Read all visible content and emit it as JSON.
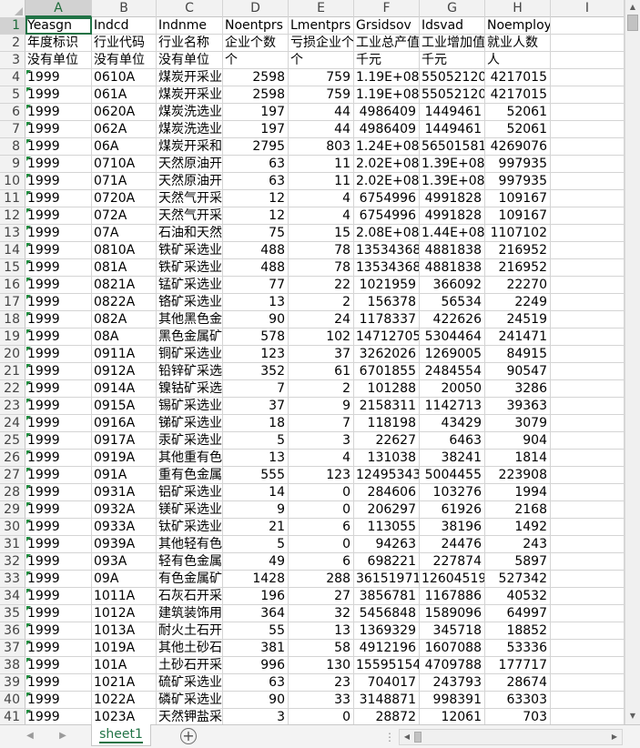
{
  "columns": [
    {
      "letter": "A"
    },
    {
      "letter": "B"
    },
    {
      "letter": "C"
    },
    {
      "letter": "D"
    },
    {
      "letter": "E"
    },
    {
      "letter": "F"
    },
    {
      "letter": "G"
    },
    {
      "letter": "H"
    },
    {
      "letter": "I"
    }
  ],
  "rows": [
    {
      "n": "1",
      "a": "Yeasgn",
      "b": "Indcd",
      "c": "Indnme",
      "d": "Noentprs",
      "e": "Lmentprs",
      "f": "Grsidsov",
      "g": "Idsvad",
      "h": "Noemploy",
      "text": true
    },
    {
      "n": "2",
      "a": "年度标识",
      "b": "行业代码",
      "c": "行业名称",
      "d": "企业个数",
      "e": "亏损企业个",
      "f": "工业总产值",
      "g": "工业增加值",
      "h": "就业人数",
      "text": true
    },
    {
      "n": "3",
      "a": "没有单位",
      "b": "没有单位",
      "c": "没有单位",
      "d": "个",
      "e": "个",
      "f": "千元",
      "g": "千元",
      "h": "人",
      "text": true
    },
    {
      "n": "4",
      "a": "1999",
      "b": "0610A",
      "c": "煤炭开采业",
      "d": "2598",
      "e": "759",
      "f": "1.19E+08",
      "g": "55052120",
      "h": "4217015"
    },
    {
      "n": "5",
      "a": "1999",
      "b": "061A",
      "c": "煤炭开采业",
      "d": "2598",
      "e": "759",
      "f": "1.19E+08",
      "g": "55052120",
      "h": "4217015"
    },
    {
      "n": "6",
      "a": "1999",
      "b": "0620A",
      "c": "煤炭洗选业",
      "d": "197",
      "e": "44",
      "f": "4986409",
      "g": "1449461",
      "h": "52061"
    },
    {
      "n": "7",
      "a": "1999",
      "b": "062A",
      "c": "煤炭洗选业",
      "d": "197",
      "e": "44",
      "f": "4986409",
      "g": "1449461",
      "h": "52061"
    },
    {
      "n": "8",
      "a": "1999",
      "b": "06A",
      "c": "煤炭开采和",
      "d": "2795",
      "e": "803",
      "f": "1.24E+08",
      "g": "56501581",
      "h": "4269076"
    },
    {
      "n": "9",
      "a": "1999",
      "b": "0710A",
      "c": "天然原油开",
      "d": "63",
      "e": "11",
      "f": "2.02E+08",
      "g": "1.39E+08",
      "h": "997935"
    },
    {
      "n": "10",
      "a": "1999",
      "b": "071A",
      "c": "天然原油开",
      "d": "63",
      "e": "11",
      "f": "2.02E+08",
      "g": "1.39E+08",
      "h": "997935"
    },
    {
      "n": "11",
      "a": "1999",
      "b": "0720A",
      "c": "天然气开采",
      "d": "12",
      "e": "4",
      "f": "6754996",
      "g": "4991828",
      "h": "109167"
    },
    {
      "n": "12",
      "a": "1999",
      "b": "072A",
      "c": "天然气开采",
      "d": "12",
      "e": "4",
      "f": "6754996",
      "g": "4991828",
      "h": "109167"
    },
    {
      "n": "13",
      "a": "1999",
      "b": "07A",
      "c": "石油和天然",
      "d": "75",
      "e": "15",
      "f": "2.08E+08",
      "g": "1.44E+08",
      "h": "1107102"
    },
    {
      "n": "14",
      "a": "1999",
      "b": "0810A",
      "c": "铁矿采选业",
      "d": "488",
      "e": "78",
      "f": "13534368",
      "g": "4881838",
      "h": "216952"
    },
    {
      "n": "15",
      "a": "1999",
      "b": "081A",
      "c": "铁矿采选业",
      "d": "488",
      "e": "78",
      "f": "13534368",
      "g": "4881838",
      "h": "216952"
    },
    {
      "n": "16",
      "a": "1999",
      "b": "0821A",
      "c": "锰矿采选业",
      "d": "77",
      "e": "22",
      "f": "1021959",
      "g": "366092",
      "h": "22270"
    },
    {
      "n": "17",
      "a": "1999",
      "b": "0822A",
      "c": "铬矿采选业",
      "d": "13",
      "e": "2",
      "f": "156378",
      "g": "56534",
      "h": "2249"
    },
    {
      "n": "18",
      "a": "1999",
      "b": "082A",
      "c": "其他黑色金",
      "d": "90",
      "e": "24",
      "f": "1178337",
      "g": "422626",
      "h": "24519"
    },
    {
      "n": "19",
      "a": "1999",
      "b": "08A",
      "c": "黑色金属矿",
      "d": "578",
      "e": "102",
      "f": "14712705",
      "g": "5304464",
      "h": "241471"
    },
    {
      "n": "20",
      "a": "1999",
      "b": "0911A",
      "c": "铜矿采选业",
      "d": "123",
      "e": "37",
      "f": "3262026",
      "g": "1269005",
      "h": "84915"
    },
    {
      "n": "21",
      "a": "1999",
      "b": "0912A",
      "c": "铅锌矿采选",
      "d": "352",
      "e": "61",
      "f": "6701855",
      "g": "2484554",
      "h": "90547"
    },
    {
      "n": "22",
      "a": "1999",
      "b": "0914A",
      "c": "镍钴矿采选",
      "d": "7",
      "e": "2",
      "f": "101288",
      "g": "20050",
      "h": "3286"
    },
    {
      "n": "23",
      "a": "1999",
      "b": "0915A",
      "c": "锡矿采选业",
      "d": "37",
      "e": "9",
      "f": "2158311",
      "g": "1142713",
      "h": "39363"
    },
    {
      "n": "24",
      "a": "1999",
      "b": "0916A",
      "c": "锑矿采选业",
      "d": "18",
      "e": "7",
      "f": "118198",
      "g": "43429",
      "h": "3079"
    },
    {
      "n": "25",
      "a": "1999",
      "b": "0917A",
      "c": "汞矿采选业",
      "d": "5",
      "e": "3",
      "f": "22627",
      "g": "6463",
      "h": "904"
    },
    {
      "n": "26",
      "a": "1999",
      "b": "0919A",
      "c": "其他重有色",
      "d": "13",
      "e": "4",
      "f": "131038",
      "g": "38241",
      "h": "1814"
    },
    {
      "n": "27",
      "a": "1999",
      "b": "091A",
      "c": "重有色金属",
      "d": "555",
      "e": "123",
      "f": "12495343",
      "g": "5004455",
      "h": "223908"
    },
    {
      "n": "28",
      "a": "1999",
      "b": "0931A",
      "c": "铝矿采选业",
      "d": "14",
      "e": "0",
      "f": "284606",
      "g": "103276",
      "h": "1994"
    },
    {
      "n": "29",
      "a": "1999",
      "b": "0932A",
      "c": "镁矿采选业",
      "d": "9",
      "e": "0",
      "f": "206297",
      "g": "61926",
      "h": "2168"
    },
    {
      "n": "30",
      "a": "1999",
      "b": "0933A",
      "c": "钛矿采选业",
      "d": "21",
      "e": "6",
      "f": "113055",
      "g": "38196",
      "h": "1492"
    },
    {
      "n": "31",
      "a": "1999",
      "b": "0939A",
      "c": "其他轻有色",
      "d": "5",
      "e": "0",
      "f": "94263",
      "g": "24476",
      "h": "243"
    },
    {
      "n": "32",
      "a": "1999",
      "b": "093A",
      "c": "轻有色金属",
      "d": "49",
      "e": "6",
      "f": "698221",
      "g": "227874",
      "h": "5897"
    },
    {
      "n": "33",
      "a": "1999",
      "b": "09A",
      "c": "有色金属矿",
      "d": "1428",
      "e": "288",
      "f": "36151971",
      "g": "12604519",
      "h": "527342"
    },
    {
      "n": "34",
      "a": "1999",
      "b": "1011A",
      "c": "石灰石开采",
      "d": "196",
      "e": "27",
      "f": "3856781",
      "g": "1167886",
      "h": "40532"
    },
    {
      "n": "35",
      "a": "1999",
      "b": "1012A",
      "c": "建筑装饰用",
      "d": "364",
      "e": "32",
      "f": "5456848",
      "g": "1589096",
      "h": "64997"
    },
    {
      "n": "36",
      "a": "1999",
      "b": "1013A",
      "c": "耐火土石开",
      "d": "55",
      "e": "13",
      "f": "1369329",
      "g": "345718",
      "h": "18852"
    },
    {
      "n": "37",
      "a": "1999",
      "b": "1019A",
      "c": "其他土砂石",
      "d": "381",
      "e": "58",
      "f": "4912196",
      "g": "1607088",
      "h": "53336"
    },
    {
      "n": "38",
      "a": "1999",
      "b": "101A",
      "c": "土砂石开采",
      "d": "996",
      "e": "130",
      "f": "15595154",
      "g": "4709788",
      "h": "177717"
    },
    {
      "n": "39",
      "a": "1999",
      "b": "1021A",
      "c": "硫矿采选业",
      "d": "63",
      "e": "23",
      "f": "704017",
      "g": "243793",
      "h": "28674"
    },
    {
      "n": "40",
      "a": "1999",
      "b": "1022A",
      "c": "磷矿采选业",
      "d": "90",
      "e": "33",
      "f": "3148871",
      "g": "998391",
      "h": "63303"
    },
    {
      "n": "41",
      "a": "1999",
      "b": "1023A",
      "c": "天然钾盐采",
      "d": "3",
      "e": "0",
      "f": "28872",
      "g": "12061",
      "h": "703"
    }
  ],
  "sheet_tab": "sheet1",
  "add_sheet_symbol": "+",
  "nav": {
    "prev": "◀",
    "next": "▶"
  },
  "scroll_arrows": {
    "up": "▲",
    "down": "▼",
    "left": "◀",
    "right": "▶"
  },
  "colors": {
    "accent": "#217346",
    "header_bg": "#f2f2f2",
    "gridline": "#d4d4d4"
  }
}
